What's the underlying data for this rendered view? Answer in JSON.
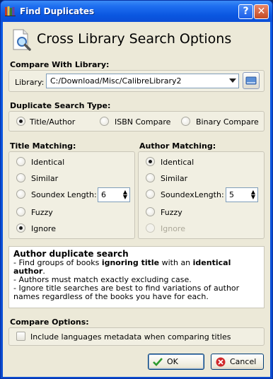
{
  "window": {
    "title": "Find Duplicates"
  },
  "header": {
    "title": "Cross Library Search Options"
  },
  "compare_library": {
    "section_label": "Compare With Library:",
    "library_label": "Library:",
    "library_value": "C:/Download/Misc/CalibreLibrary2"
  },
  "search_type": {
    "section_label": "Duplicate Search Type:",
    "options": [
      "Title/Author",
      "ISBN Compare",
      "Binary Compare"
    ]
  },
  "title_matching": {
    "section_label": "Title Matching:",
    "identical": "Identical",
    "similar": "Similar",
    "soundex": "Soundex",
    "length_label": "Length:",
    "length_value": "6",
    "fuzzy": "Fuzzy",
    "ignore": "Ignore",
    "selected": "Ignore"
  },
  "author_matching": {
    "section_label": "Author Matching:",
    "identical": "Identical",
    "similar": "Similar",
    "soundex": "Soundex",
    "length_label": "Length:",
    "length_value": "5",
    "fuzzy": "Fuzzy",
    "ignore": "Ignore",
    "selected": "Identical"
  },
  "help": {
    "title": "Author duplicate search",
    "line1_a": "- Find groups of books ",
    "line1_b": "ignoring title",
    "line1_c": " with an ",
    "line1_d": "identical author",
    "line1_e": ".",
    "line2": "- Authors must match exactly excluding case.",
    "line3": "- Ignore title searches are best to find variations of author names regardless of the books you have for each."
  },
  "compare_options": {
    "section_label": "Compare Options:",
    "include_languages": "Include languages metadata when comparing titles"
  },
  "buttons": {
    "ok": "OK",
    "cancel": "Cancel"
  },
  "colors": {
    "titlebar": "#0a56e0",
    "client_bg": "#ece9d8",
    "ok_icon": "#2e9a2e",
    "cancel_icon": "#d0282b"
  }
}
